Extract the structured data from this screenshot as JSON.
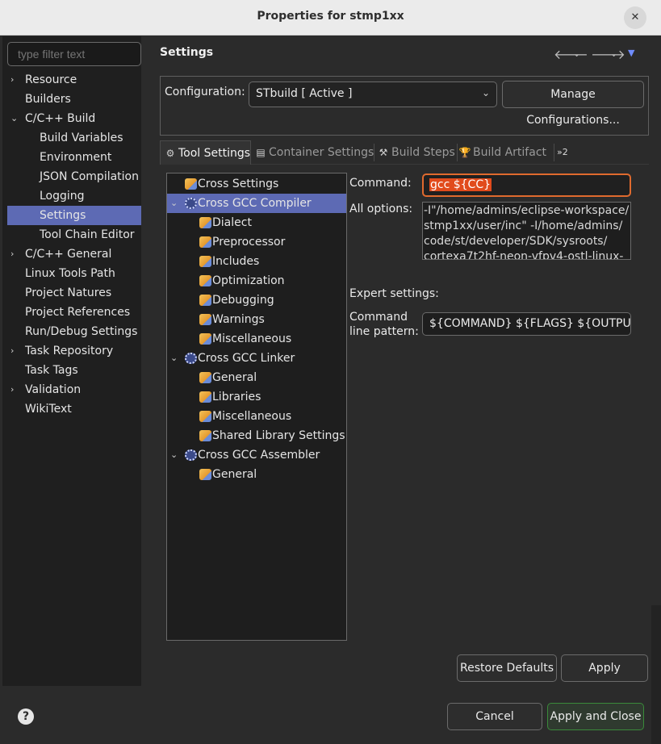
{
  "window": {
    "title": "Properties for stmp1xx",
    "close_glyph": "✕"
  },
  "filter": {
    "placeholder": "type filter text"
  },
  "sidebar": {
    "items": [
      {
        "label": "Resource",
        "expandable": true,
        "level": 0
      },
      {
        "label": "Builders",
        "expandable": false,
        "level": 0
      },
      {
        "label": "C/C++ Build",
        "expandable": true,
        "expanded": true,
        "level": 0
      },
      {
        "label": "Build Variables",
        "level": 1
      },
      {
        "label": "Environment",
        "level": 1
      },
      {
        "label": "JSON Compilation",
        "level": 1
      },
      {
        "label": "Logging",
        "level": 1
      },
      {
        "label": "Settings",
        "level": 1,
        "selected": true
      },
      {
        "label": "Tool Chain Editor",
        "level": 1
      },
      {
        "label": "C/C++ General",
        "expandable": true,
        "level": 0
      },
      {
        "label": "Linux Tools Path",
        "level": 0
      },
      {
        "label": "Project Natures",
        "level": 0
      },
      {
        "label": "Project References",
        "level": 0
      },
      {
        "label": "Run/Debug Settings",
        "level": 0
      },
      {
        "label": "Task Repository",
        "expandable": true,
        "level": 0
      },
      {
        "label": "Task Tags",
        "level": 0
      },
      {
        "label": "Validation",
        "expandable": true,
        "level": 0
      },
      {
        "label": "WikiText",
        "level": 0
      }
    ]
  },
  "header": {
    "title": "Settings"
  },
  "configuration": {
    "label": "Configuration:",
    "selected": "STbuild  [ Active ]",
    "manage_label": "Manage Configurations..."
  },
  "tabs": [
    {
      "label": "Tool Settings",
      "active": true,
      "icon": "gear-icon"
    },
    {
      "label": "Container Settings",
      "icon": "container-icon"
    },
    {
      "label": "Build Steps",
      "icon": "hammer-icon"
    },
    {
      "label": "Build Artifact",
      "icon": "trophy-icon"
    },
    {
      "label": "»2",
      "icon": "overflow-icon"
    }
  ],
  "tool_tree": [
    {
      "label": "Cross Settings",
      "level": 0,
      "icon": "options-icon"
    },
    {
      "label": "Cross GCC Compiler",
      "level": 0,
      "icon": "gear-icon",
      "expanded": true,
      "selected": true
    },
    {
      "label": "Dialect",
      "level": 1,
      "icon": "options-icon"
    },
    {
      "label": "Preprocessor",
      "level": 1,
      "icon": "options-icon"
    },
    {
      "label": "Includes",
      "level": 1,
      "icon": "options-icon"
    },
    {
      "label": "Optimization",
      "level": 1,
      "icon": "options-icon"
    },
    {
      "label": "Debugging",
      "level": 1,
      "icon": "options-icon"
    },
    {
      "label": "Warnings",
      "level": 1,
      "icon": "options-icon"
    },
    {
      "label": "Miscellaneous",
      "level": 1,
      "icon": "options-icon"
    },
    {
      "label": "Cross GCC Linker",
      "level": 0,
      "icon": "gear-icon",
      "expanded": true
    },
    {
      "label": "General",
      "level": 1,
      "icon": "options-icon"
    },
    {
      "label": "Libraries",
      "level": 1,
      "icon": "options-icon"
    },
    {
      "label": "Miscellaneous",
      "level": 1,
      "icon": "options-icon"
    },
    {
      "label": "Shared Library Settings",
      "level": 1,
      "icon": "options-icon"
    },
    {
      "label": "Cross GCC Assembler",
      "level": 0,
      "icon": "gear-icon",
      "expanded": true
    },
    {
      "label": "General",
      "level": 1,
      "icon": "options-icon"
    }
  ],
  "form": {
    "command_label": "Command:",
    "command_value": "gcc ${CC}",
    "all_options_label": "All options:",
    "all_options_lines": [
      "-I\"/home/admins/eclipse-workspace/",
      "stmp1xx/user/inc\" -I/home/admins/",
      "code/st/developer/SDK/sysroots/",
      "cortexa7t2hf-neon-vfpv4-ostl-linux-"
    ],
    "expert_label": "Expert settings:",
    "pattern_label_1": "Command",
    "pattern_label_2": "line pattern:",
    "pattern_value": "${COMMAND} ${FLAGS} ${OUTPUT_F"
  },
  "buttons": {
    "restore": "Restore Defaults",
    "apply": "Apply",
    "cancel": "Cancel",
    "apply_close": "Apply and Close",
    "help": "?"
  },
  "colors": {
    "selection": "#5d6ab4",
    "command_highlight": "#e14b1c",
    "focus_border": "#e06a2e"
  }
}
